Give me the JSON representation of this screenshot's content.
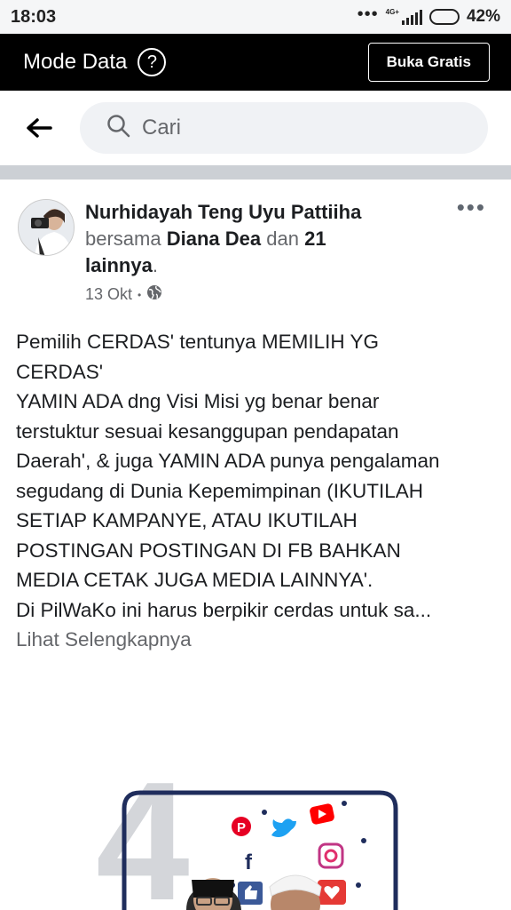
{
  "status_bar": {
    "time": "18:03",
    "more": "•••",
    "network": "4G+",
    "battery": "42%",
    "battery_level": 0.42
  },
  "data_bar": {
    "title": "Mode Data",
    "help": "?",
    "free_button": "Buka Gratis"
  },
  "search": {
    "placeholder": "Cari"
  },
  "post": {
    "author": "Nurhidayah Teng Uyu Pattiiha",
    "with_prefix": "bersama",
    "tagged": "Diana Dea",
    "and": "dan",
    "others_count": "21",
    "others_label": "lainnya",
    "period": ".",
    "date": "13 Okt",
    "dot": "•",
    "more": "•••",
    "lines": [
      "Pemilih CERDAS' tentunya MEMILIH YG",
      "CERDAS'",
      "YAMIN ADA dng Visi Misi yg benar benar",
      "terstuktur sesuai kesanggupan pendapatan",
      "Daerah', & juga YAMIN ADA punya pengalaman",
      "segudang di Dunia Kepemimpinan (IKUTILAH",
      "SETIAP KAMPANYE, ATAU IKUTILAH",
      "POSTINGAN POSTINGAN DI FB BAHKAN",
      "MEDIA CETAK JUGA MEDIA LAINNYA'.",
      "Di PilWaKo ini harus berpikir cerdas untuk sa..."
    ],
    "see_more": "Lihat Selengkapnya",
    "image": {
      "number": "4",
      "social_icons": [
        "pinterest-icon",
        "twitter-icon",
        "youtube-icon",
        "facebook-icon",
        "instagram-icon",
        "like-icon",
        "heart-icon"
      ]
    }
  }
}
